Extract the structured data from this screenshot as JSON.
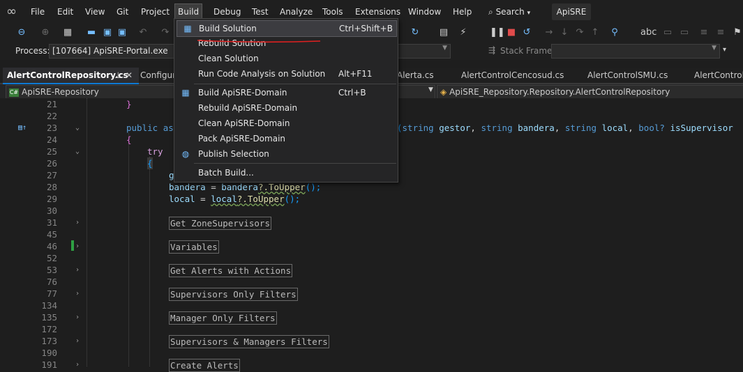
{
  "menubar": {
    "items": [
      "File",
      "Edit",
      "View",
      "Git",
      "Project",
      "Build",
      "Debug",
      "Test",
      "Analyze",
      "Tools",
      "Extensions",
      "Window",
      "Help"
    ],
    "active": "Build",
    "search_label": "Search",
    "solution_name": "ApiSRE"
  },
  "processbar": {
    "process_label": "Process:",
    "process_value": "[107664] ApiSRE-Portal.exe",
    "stack_frame_label": "Stack Frame:"
  },
  "tabs": [
    "AlertControlRepository.cs",
    "Configur",
    "Alerta.cs",
    "AlertControlCencosud.cs",
    "AlertControlSMU.cs",
    "AlertControlT"
  ],
  "navbar": {
    "project": "ApiSRE-Repository",
    "type": "ApiSRE_Repository.Repository.AlertControlRepository"
  },
  "build_menu": {
    "items": [
      {
        "label": "Build Solution",
        "shortcut": "Ctrl+Shift+B",
        "icon": "build-icon"
      },
      {
        "label": "Rebuild Solution",
        "shortcut": ""
      },
      {
        "label": "Clean Solution",
        "shortcut": ""
      },
      {
        "label": "Run Code Analysis on Solution",
        "shortcut": "Alt+F11"
      },
      {
        "label": "Build ApiSRE-Domain",
        "shortcut": "Ctrl+B",
        "icon": "build-icon"
      },
      {
        "label": "Rebuild ApiSRE-Domain",
        "shortcut": ""
      },
      {
        "label": "Clean ApiSRE-Domain",
        "shortcut": ""
      },
      {
        "label": "Pack ApiSRE-Domain",
        "shortcut": ""
      },
      {
        "label": "Publish Selection",
        "shortcut": "",
        "icon": "globe-icon"
      },
      {
        "label": "Batch Build...",
        "shortcut": ""
      }
    ]
  },
  "editor": {
    "line_numbers": [
      "21",
      "22",
      "23",
      "24",
      "25",
      "26",
      "27",
      "28",
      "29",
      "30",
      "31",
      "45",
      "46",
      "52",
      "53",
      "76",
      "77",
      "134",
      "135",
      "172",
      "173",
      "190",
      "191"
    ],
    "line_21": "}",
    "line_23_kw1": "public",
    "line_23_kw2": "as",
    "line_23_rest_paren": "(",
    "line_23_t1": "string",
    "line_23_p1": "gestor",
    "line_23_t2": "string",
    "line_23_p2": "bandera",
    "line_23_t3": "string",
    "line_23_p3": "local",
    "line_23_t4": "bool?",
    "line_23_p4": "isSupervisor",
    "line_24": "{",
    "line_25": "try",
    "line_26": "{",
    "line_27": "g",
    "line_28_var": "bandera",
    "line_28_eq": " = ",
    "line_28_src": "bandera",
    "line_28_call": "?.ToUpper",
    "line_28_end": "();",
    "line_29_var": "local",
    "line_29_eq": " = ",
    "line_29_src": "local",
    "line_29_call": "?.ToUpper",
    "line_29_end": "();",
    "regions": [
      "Get ZoneSupervisors",
      "Variables",
      "Get Alerts with Actions",
      "Supervisors Only Filters",
      "Manager Only Filters",
      "Supervisors & Managers Filters",
      "Create Alerts"
    ]
  }
}
